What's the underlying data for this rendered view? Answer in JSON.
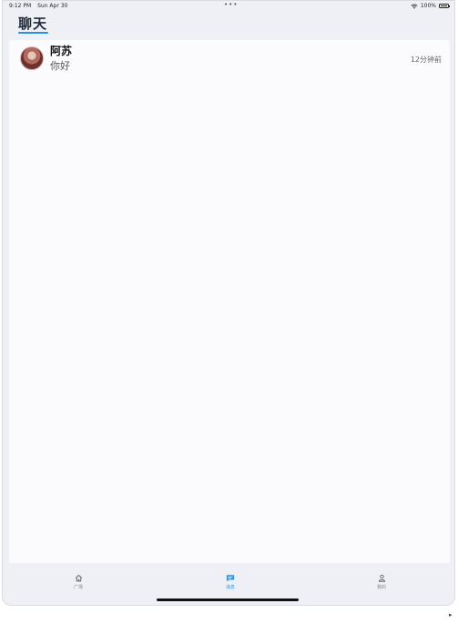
{
  "status_bar": {
    "time": "9:12 PM",
    "date": "Sun Apr 30",
    "battery": "100%"
  },
  "header": {
    "title": "聊天"
  },
  "chats": [
    {
      "name": "阿苏",
      "preview": "你好",
      "time": "12分钟前"
    }
  ],
  "tabbar": {
    "items": [
      {
        "label": "广场",
        "icon": "home-icon",
        "active": false
      },
      {
        "label": "消息",
        "icon": "message-icon",
        "active": true
      },
      {
        "label": "我的",
        "icon": "user-icon",
        "active": false
      }
    ]
  },
  "colors": {
    "accent": "#2a92e6",
    "background": "#eef0f6",
    "panel": "#fbfbfe"
  }
}
